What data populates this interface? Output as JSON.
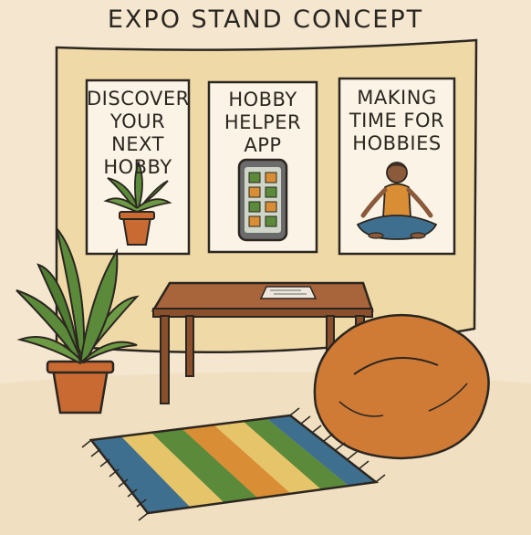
{
  "title": "EXPO STAND CONCEPT",
  "posters": [
    {
      "lines": [
        "DISCOVER",
        "YOUR NEXT",
        "HOBBY"
      ],
      "icon": "potted-plant-icon"
    },
    {
      "lines": [
        "HOBBY",
        "HELPER",
        "APP"
      ],
      "icon": "smartphone-app-icon"
    },
    {
      "lines": [
        "MAKING",
        "TIME FOR",
        "HOBBIES"
      ],
      "icon": "meditating-person-icon"
    }
  ],
  "colors": {
    "background": "#f4e6cf",
    "wall": "#efd9a6",
    "poster": "#fbf4e6",
    "wood": "#a8643a",
    "beanbag": "#cf7a35",
    "plant": "#5b8a3a",
    "pot": "#c96a32",
    "rug_stripes": [
      "#3f6f8f",
      "#d98d35",
      "#e6c46a",
      "#5b8a3a"
    ]
  }
}
